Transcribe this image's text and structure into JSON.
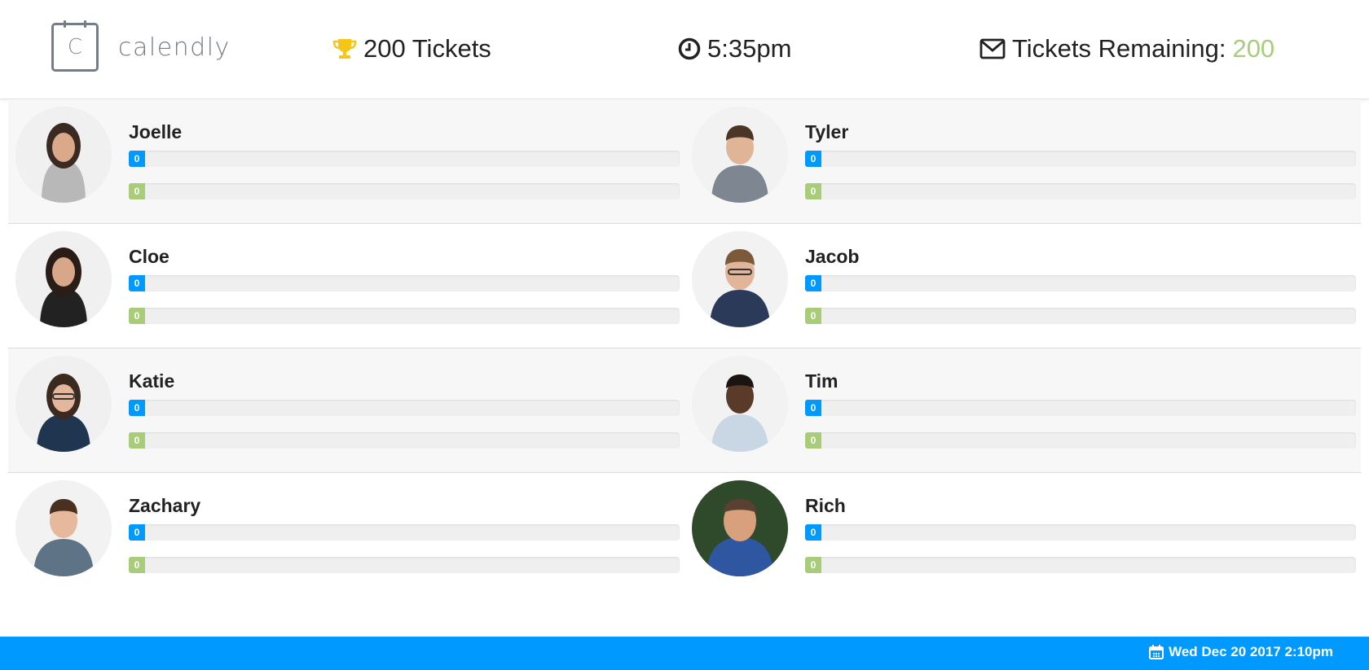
{
  "brand": {
    "name": "calendly",
    "letter": "C"
  },
  "header": {
    "tickets": "200 Tickets",
    "time": "5:35pm",
    "remaining_label": "Tickets Remaining:",
    "remaining_value": "200"
  },
  "colors": {
    "accent_blue": "#0099ff",
    "accent_green": "#a8cc7a"
  },
  "people": [
    {
      "name": "Joelle",
      "blue": 0,
      "green": 0,
      "blue_fraction": 0,
      "green_fraction": 0
    },
    {
      "name": "Tyler",
      "blue": 0,
      "green": 0,
      "blue_fraction": 0,
      "green_fraction": 0
    },
    {
      "name": "Cloe",
      "blue": 0,
      "green": 0,
      "blue_fraction": 0,
      "green_fraction": 0
    },
    {
      "name": "Jacob",
      "blue": 0,
      "green": 0,
      "blue_fraction": 0,
      "green_fraction": 0
    },
    {
      "name": "Katie",
      "blue": 0,
      "green": 0,
      "blue_fraction": 0,
      "green_fraction": 0
    },
    {
      "name": "Tim",
      "blue": 0,
      "green": 0,
      "blue_fraction": 0,
      "green_fraction": 0
    },
    {
      "name": "Zachary",
      "blue": 0,
      "green": 0,
      "blue_fraction": 0,
      "green_fraction": 0
    },
    {
      "name": "Rich",
      "blue": 0,
      "green": 0,
      "blue_fraction": 0,
      "green_fraction": 0
    }
  ],
  "footer": {
    "date": "Wed Dec 20 2017 2:10pm"
  }
}
